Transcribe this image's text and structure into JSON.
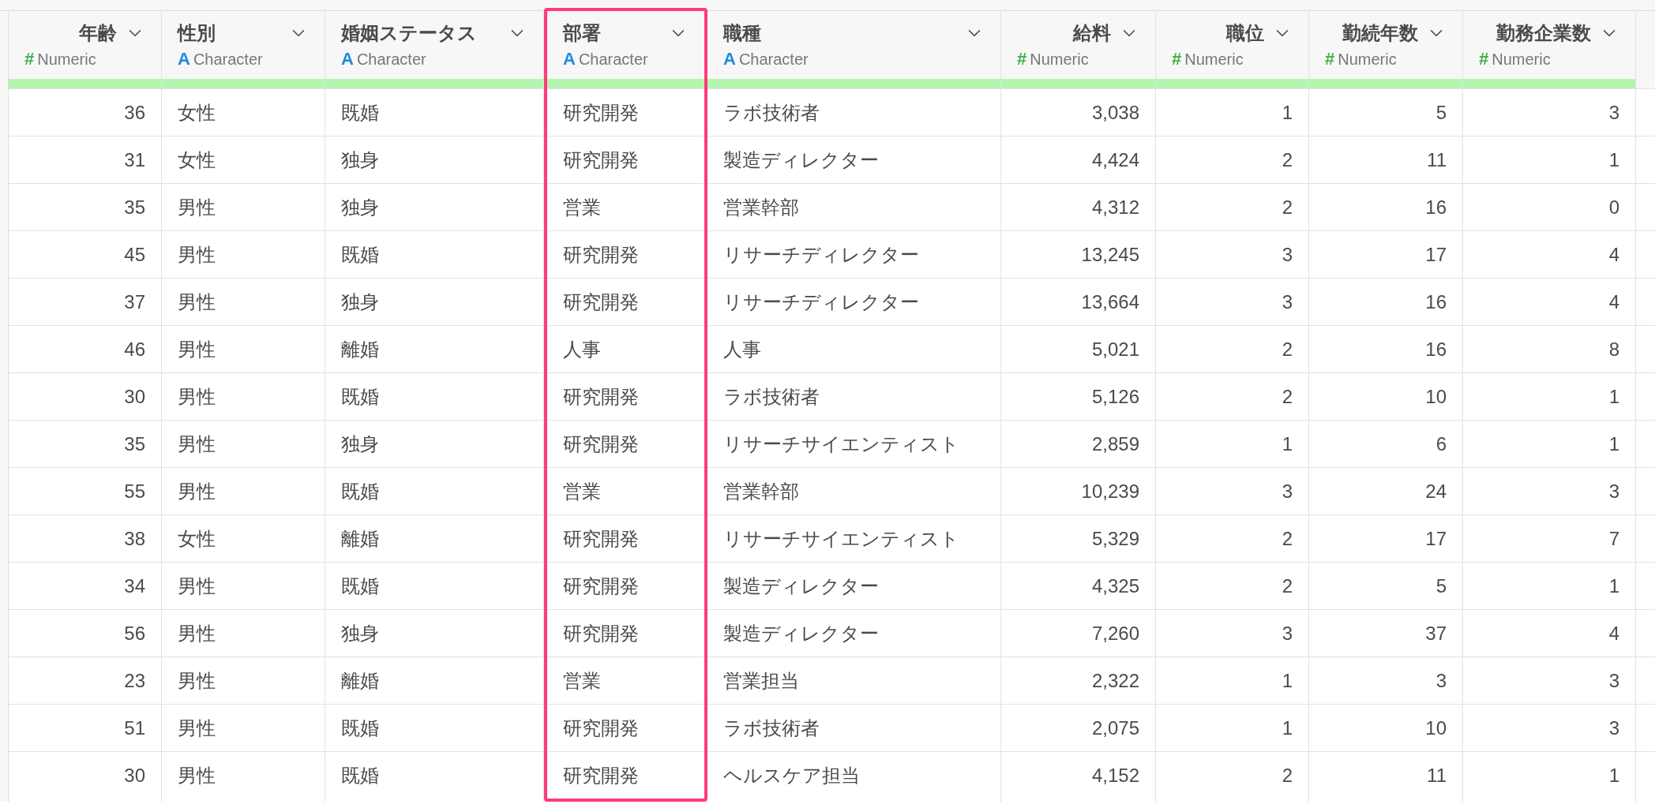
{
  "columns": [
    {
      "title": "年齢",
      "type_icon": "#",
      "type_label": "Numeric",
      "kind": "numeric",
      "selected": false
    },
    {
      "title": "性別",
      "type_icon": "A",
      "type_label": "Character",
      "kind": "character",
      "selected": false
    },
    {
      "title": "婚姻ステータス",
      "type_icon": "A",
      "type_label": "Character",
      "kind": "character",
      "selected": false
    },
    {
      "title": "部署",
      "type_icon": "A",
      "type_label": "Character",
      "kind": "character",
      "selected": true
    },
    {
      "title": "職種",
      "type_icon": "A",
      "type_label": "Character",
      "kind": "character",
      "selected": false
    },
    {
      "title": "給料",
      "type_icon": "#",
      "type_label": "Numeric",
      "kind": "numeric",
      "selected": false
    },
    {
      "title": "職位",
      "type_icon": "#",
      "type_label": "Numeric",
      "kind": "numeric",
      "selected": false
    },
    {
      "title": "勤続年数",
      "type_icon": "#",
      "type_label": "Numeric",
      "kind": "numeric",
      "selected": false
    },
    {
      "title": "勤務企業数",
      "type_icon": "#",
      "type_label": "Numeric",
      "kind": "numeric",
      "selected": false
    }
  ],
  "rows": [
    [
      "36",
      "女性",
      "既婚",
      "研究開発",
      "ラボ技術者",
      "3,038",
      "1",
      "5",
      "3"
    ],
    [
      "31",
      "女性",
      "独身",
      "研究開発",
      "製造ディレクター",
      "4,424",
      "2",
      "11",
      "1"
    ],
    [
      "35",
      "男性",
      "独身",
      "営業",
      "営業幹部",
      "4,312",
      "2",
      "16",
      "0"
    ],
    [
      "45",
      "男性",
      "既婚",
      "研究開発",
      "リサーチディレクター",
      "13,245",
      "3",
      "17",
      "4"
    ],
    [
      "37",
      "男性",
      "独身",
      "研究開発",
      "リサーチディレクター",
      "13,664",
      "3",
      "16",
      "4"
    ],
    [
      "46",
      "男性",
      "離婚",
      "人事",
      "人事",
      "5,021",
      "2",
      "16",
      "8"
    ],
    [
      "30",
      "男性",
      "既婚",
      "研究開発",
      "ラボ技術者",
      "5,126",
      "2",
      "10",
      "1"
    ],
    [
      "35",
      "男性",
      "独身",
      "研究開発",
      "リサーチサイエンティスト",
      "2,859",
      "1",
      "6",
      "1"
    ],
    [
      "55",
      "男性",
      "既婚",
      "営業",
      "営業幹部",
      "10,239",
      "3",
      "24",
      "3"
    ],
    [
      "38",
      "女性",
      "離婚",
      "研究開発",
      "リサーチサイエンティスト",
      "5,329",
      "2",
      "17",
      "7"
    ],
    [
      "34",
      "男性",
      "既婚",
      "研究開発",
      "製造ディレクター",
      "4,325",
      "2",
      "5",
      "1"
    ],
    [
      "56",
      "男性",
      "独身",
      "研究開発",
      "製造ディレクター",
      "7,260",
      "3",
      "37",
      "4"
    ],
    [
      "23",
      "男性",
      "離婚",
      "営業",
      "営業担当",
      "2,322",
      "1",
      "3",
      "3"
    ],
    [
      "51",
      "男性",
      "既婚",
      "研究開発",
      "ラボ技術者",
      "2,075",
      "1",
      "10",
      "3"
    ],
    [
      "30",
      "男性",
      "既婚",
      "研究開発",
      "ヘルスケア担当",
      "4,152",
      "2",
      "11",
      "1"
    ]
  ]
}
